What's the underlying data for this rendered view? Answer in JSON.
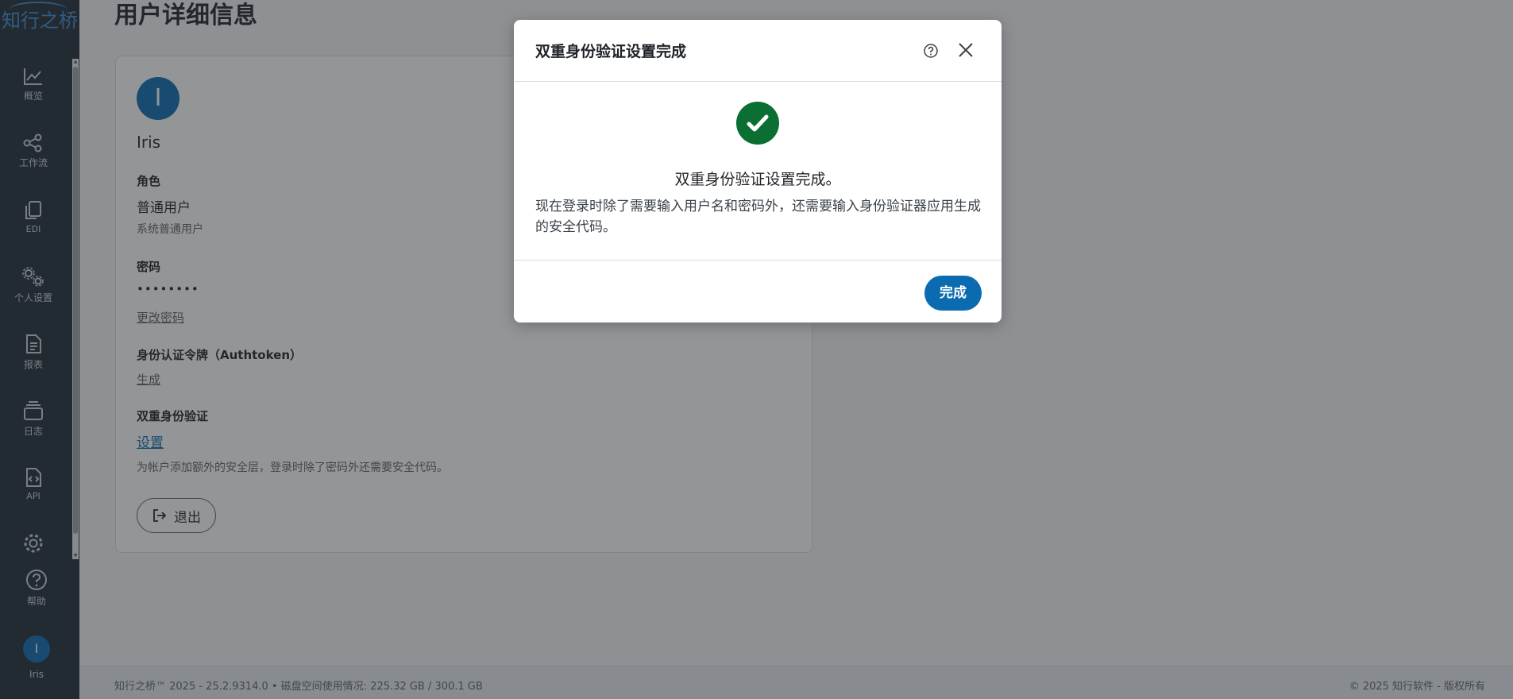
{
  "app": {
    "logo_text": "知行之桥"
  },
  "sidebar": {
    "items": [
      {
        "label": "概览",
        "icon": "chart-line-icon"
      },
      {
        "label": "工作流",
        "icon": "share-nodes-icon"
      },
      {
        "label": "EDI",
        "icon": "copy-documents-icon"
      },
      {
        "label": "个人设置",
        "icon": "gears-icon"
      },
      {
        "label": "报表",
        "icon": "file-text-icon"
      },
      {
        "label": "日志",
        "icon": "layers-stack-icon"
      },
      {
        "label": "API",
        "icon": "file-code-icon"
      }
    ],
    "settings_icon": "gear-icon",
    "help_label": "帮助",
    "user_initial": "I",
    "user_name": "Iris"
  },
  "page": {
    "title": "用户详细信息",
    "user": {
      "initial": "I",
      "name": "Iris"
    },
    "role": {
      "label": "角色",
      "value": "普通用户",
      "description": "系统普通用户"
    },
    "password": {
      "label": "密码",
      "value": "••••••••",
      "change_link": "更改密码"
    },
    "authtoken": {
      "label": "身份认证令牌（Authtoken）",
      "generate_link": "生成"
    },
    "two_factor": {
      "label": "双重身份验证",
      "setup_link": "设置",
      "description": "为帐户添加额外的安全层，登录时除了密码外还需要安全代码。"
    },
    "logout_label": "退出"
  },
  "footer": {
    "left": "知行之桥™ 2025 - 25.2.9314.0  •  磁盘空间使用情况:  225.32 GB / 300.1 GB",
    "right": "© 2025 知行软件 - 版权所有"
  },
  "dialog": {
    "title": "双重身份验证设置完成",
    "success_title": "双重身份验证设置完成。",
    "description": "现在登录时除了需要输入用户名和密码外，还需要输入身份验证器应用生成的安全代码。",
    "done_label": "完成",
    "success_color": "#0b6e33",
    "accent_color": "#0a6bb0"
  }
}
